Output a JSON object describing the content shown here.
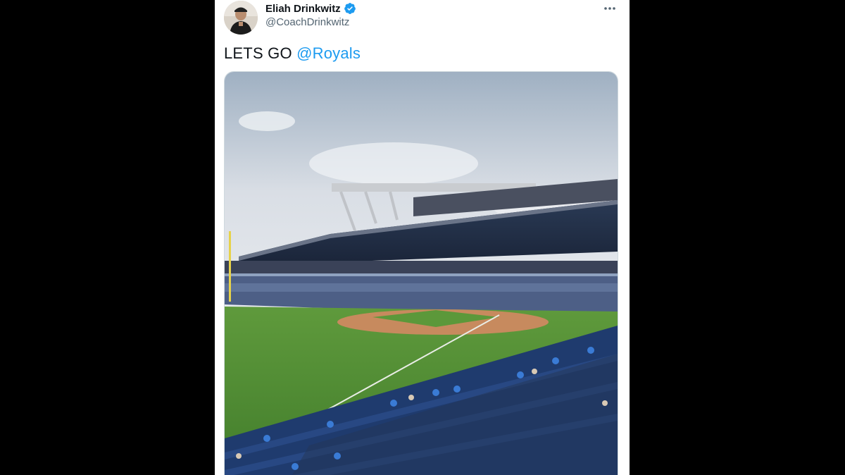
{
  "tweet": {
    "author": {
      "display_name": "Eliah Drinkwitz",
      "handle": "@CoachDrinkwitz",
      "verified": true
    },
    "text": "LETS GO ",
    "mention": "@Royals",
    "media": {
      "kind": "photo"
    },
    "icons": {
      "verified": "verified-badge-icon",
      "more": "more-options-icon"
    }
  },
  "colors": {
    "page_background": "#000000",
    "card_background": "#ffffff",
    "link": "#1d9bf0",
    "secondary_text": "#536471",
    "primary_text": "#0f1419"
  }
}
